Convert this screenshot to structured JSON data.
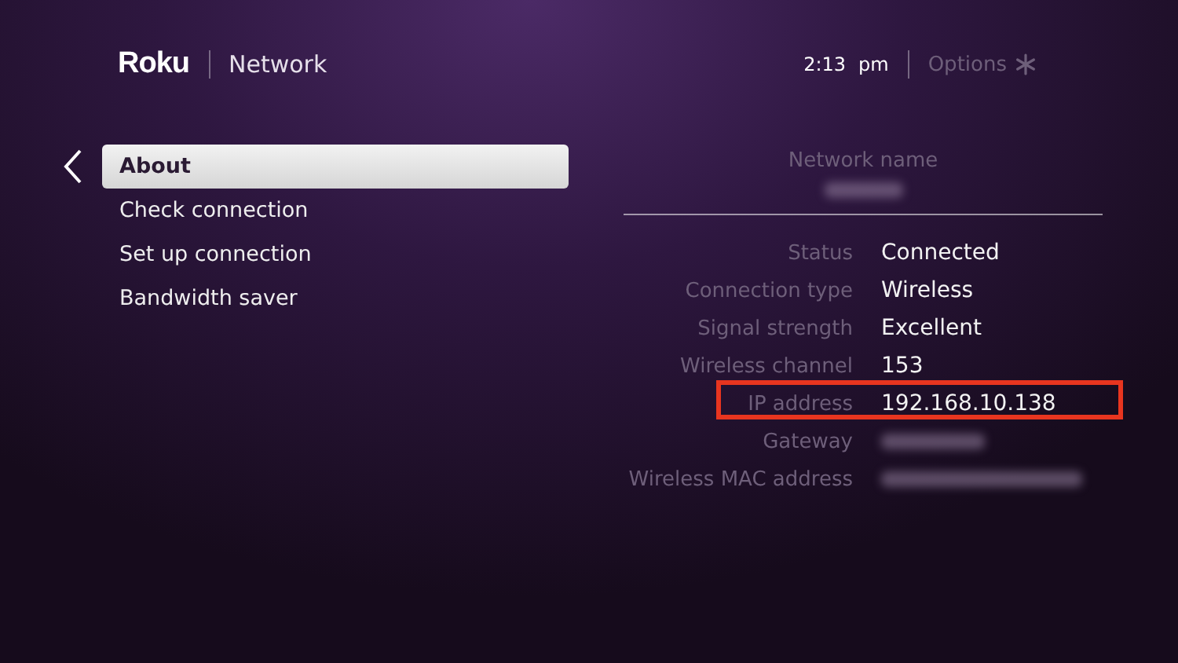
{
  "header": {
    "logo": "Roku",
    "title": "Network",
    "time": "2:13",
    "meridiem": "pm",
    "options": "Options"
  },
  "menu": [
    {
      "label": "About",
      "selected": true
    },
    {
      "label": "Check connection",
      "selected": false
    },
    {
      "label": "Set up connection",
      "selected": false
    },
    {
      "label": "Bandwidth saver",
      "selected": false
    }
  ],
  "network_name": {
    "label": "Network name",
    "kind": "blurred"
  },
  "details": [
    {
      "label": "Status",
      "kind": "text",
      "value": "Connected",
      "highlighted": false
    },
    {
      "label": "Connection type",
      "kind": "text",
      "value": "Wireless",
      "highlighted": false
    },
    {
      "label": "Signal strength",
      "kind": "text",
      "value": "Excellent",
      "highlighted": false
    },
    {
      "label": "Wireless channel",
      "kind": "text",
      "value": "153",
      "highlighted": false
    },
    {
      "label": "IP address",
      "kind": "text",
      "value": "192.168.10.138",
      "highlighted": true
    },
    {
      "label": "Gateway",
      "kind": "blurred",
      "highlighted": false
    },
    {
      "label": "Wireless MAC address",
      "kind": "blurred",
      "highlighted": false
    }
  ]
}
